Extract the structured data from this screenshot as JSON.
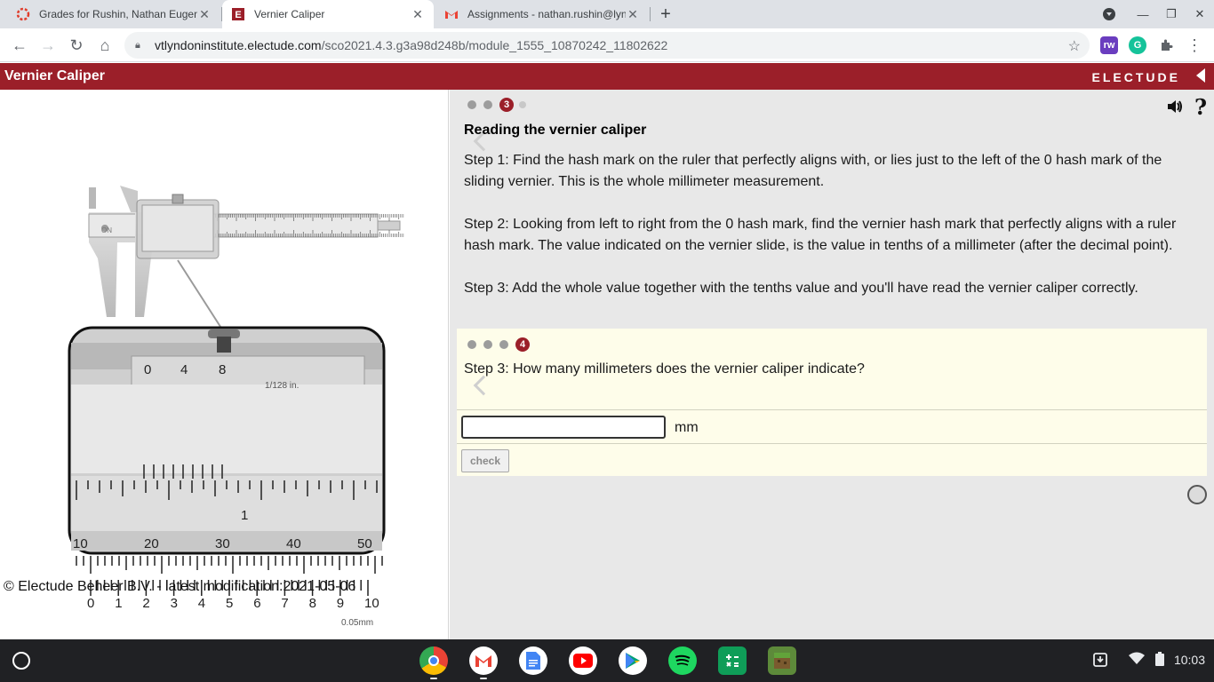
{
  "browser": {
    "tabs": [
      {
        "title": "Grades for Rushin, Nathan Eugene",
        "active": false
      },
      {
        "title": "Vernier Caliper",
        "active": true
      },
      {
        "title": "Assignments - nathan.rushin@lyndoninstitute.org",
        "active": false
      }
    ],
    "url_host": "vtlyndoninstitute.electude.com",
    "url_path": "/sco2021.4.3.g3a98d248b/module_1555_10870242_11802622",
    "extension_labels": [
      "rw",
      "G"
    ]
  },
  "app": {
    "title": "Vernier Caliper",
    "brand": "ELECTUDE"
  },
  "left": {
    "copyright": "© Electude Beheer B.V. - latest modification:2021-05-06",
    "figure": {
      "vernier_labels": [
        "0",
        "4",
        "8"
      ],
      "inch_label": "1/128 in.",
      "inch_numeral": "1",
      "mm_labels": [
        "10",
        "20",
        "30",
        "40",
        "50"
      ],
      "vernier_mm_labels": [
        "0",
        "1",
        "2",
        "3",
        "4",
        "5",
        "6",
        "7",
        "8",
        "9",
        "10"
      ],
      "resolution_label": "0.05mm"
    }
  },
  "lesson": {
    "current_step": "3",
    "heading": "Reading the vernier caliper",
    "step1": "Step 1: Find the hash mark on the ruler that perfectly aligns with, or lies just to the left of the 0 hash mark of the sliding vernier. This is the whole millimeter measurement.",
    "step2": "Step 2: Looking from left to right from the 0 hash mark, find the vernier hash mark that perfectly aligns with a ruler hash mark. The value indicated on the vernier slide, is the value in tenths of a millimeter (after the decimal point).",
    "step3": "Step 3: Add the whole value together with the tenths value and you'll have read the vernier caliper correctly."
  },
  "question": {
    "current_step": "4",
    "text": "Step 3: How many millimeters does the vernier caliper indicate?",
    "answer_value": "",
    "unit": "mm",
    "check_label": "check"
  },
  "shelf": {
    "clock": "10:03"
  },
  "colors": {
    "brand_red": "#9b1f29",
    "question_bg": "#fefdea",
    "panel_bg": "#e8e8e8"
  }
}
